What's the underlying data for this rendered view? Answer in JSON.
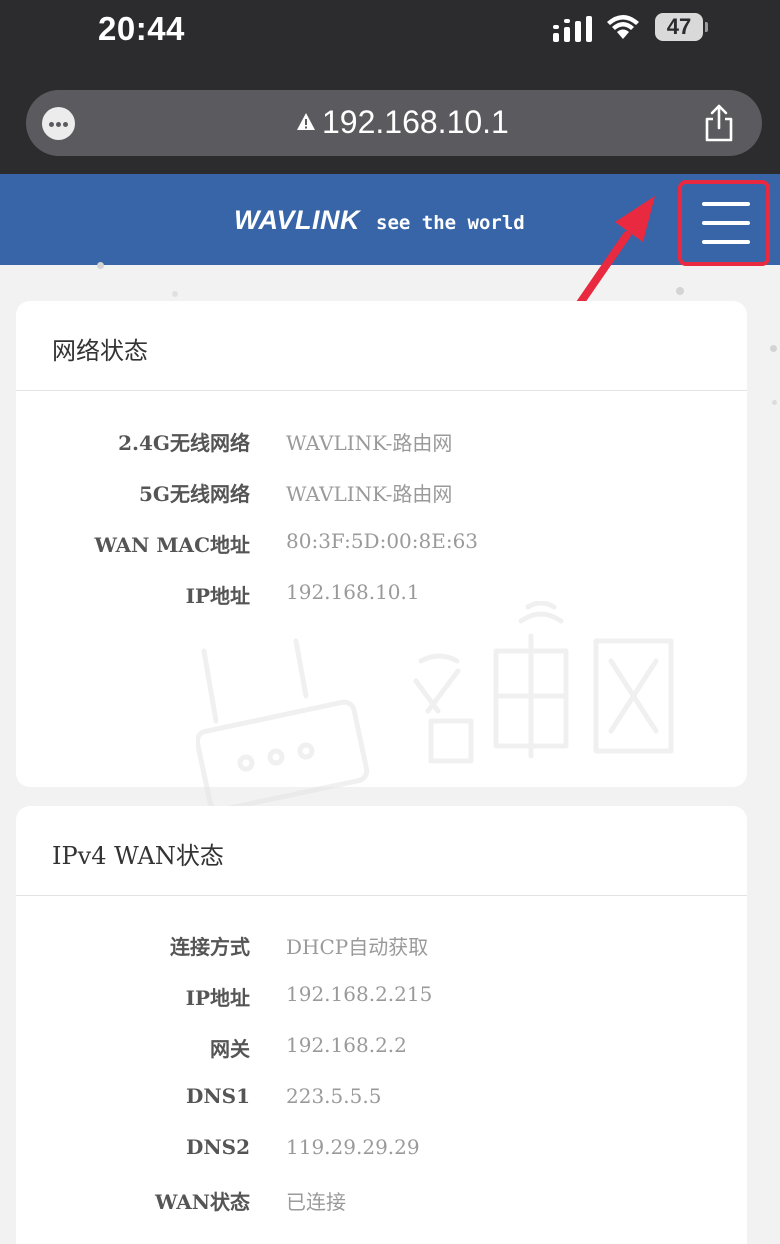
{
  "status_bar": {
    "time": "20:44",
    "battery_level": "47",
    "icons": [
      "signal-icon",
      "wifi-icon",
      "battery-icon"
    ]
  },
  "browser": {
    "url": "192.168.10.1",
    "icons": [
      "more-icon",
      "warning-icon",
      "share-icon"
    ]
  },
  "header": {
    "logo": "WAVLINK",
    "slogan": "see the world",
    "background": "#3765a8",
    "menu_icon": "hamburger-menu-icon",
    "highlight_color": "#e8293f"
  },
  "network_status": {
    "title": "网络状态",
    "rows": [
      {
        "label": "2.4G无线网络",
        "value": "WAVLINK-路由网"
      },
      {
        "label": "5G无线网络",
        "value": "WAVLINK-路由网"
      },
      {
        "label": "WAN MAC地址",
        "value": "80:3F:5D:00:8E:63"
      },
      {
        "label": "IP地址",
        "value": "192.168.10.1"
      }
    ]
  },
  "ipv4_wan_status": {
    "title": "IPv4 WAN状态",
    "rows": [
      {
        "label": "连接方式",
        "value": "DHCP自动获取"
      },
      {
        "label": "IP地址",
        "value": "192.168.2.215"
      },
      {
        "label": "网关",
        "value": "192.168.2.2"
      },
      {
        "label": "DNS1",
        "value": "223.5.5.5"
      },
      {
        "label": "DNS2",
        "value": "119.29.29.29"
      },
      {
        "label": "WAN状态",
        "value": "已连接"
      }
    ]
  }
}
